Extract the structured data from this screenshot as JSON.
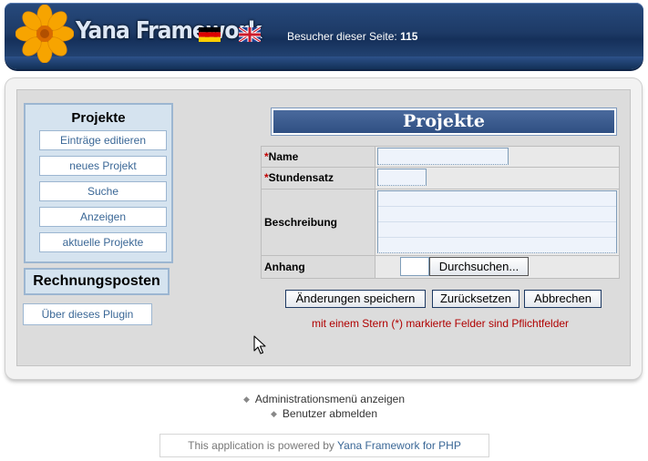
{
  "header": {
    "logo_text": "Yana Framework",
    "visitors_label": "Besucher dieser Seite:",
    "visitors_count": "115"
  },
  "menu": {
    "title": "Projekte",
    "items": [
      "Einträge editieren",
      "neues Projekt",
      "Suche",
      "Anzeigen",
      "aktuelle Projekte"
    ],
    "section2": "Rechnungsposten",
    "about": "Über dieses Plugin"
  },
  "form": {
    "title": "Projekte",
    "required_mark": "*",
    "fields": {
      "name": "Name",
      "rate": "Stundensatz",
      "description": "Beschreibung",
      "attachment": "Anhang"
    },
    "browse_label": "Durchsuchen...",
    "buttons": {
      "save": "Änderungen speichern",
      "reset": "Zurücksetzen",
      "cancel": "Abbrechen"
    },
    "required_note": "mit einem Stern (*) markierte Felder sind Pflichtfelder"
  },
  "footer": {
    "admin_menu": "Administrationsmenü anzeigen",
    "logout": "Benutzer abmelden",
    "powered_prefix": "This application is powered by",
    "powered_link": "Yana Framework for PHP"
  },
  "colors": {
    "header_blue": "#1d3a66",
    "menu_bg": "#d5e3ef",
    "link_blue": "#3a6796",
    "required_red": "#b00000"
  }
}
